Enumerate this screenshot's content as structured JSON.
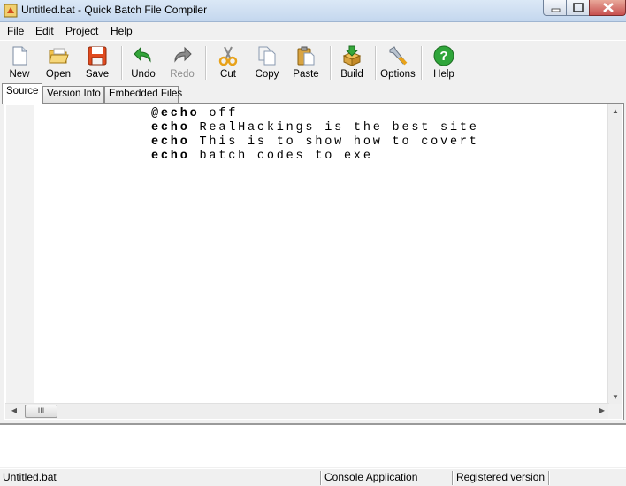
{
  "window": {
    "title": "Untitled.bat - Quick Batch File Compiler"
  },
  "menu": [
    "File",
    "Edit",
    "Project",
    "Help"
  ],
  "toolbar": {
    "new": "New",
    "open": "Open",
    "save": "Save",
    "undo": "Undo",
    "redo": "Redo",
    "cut": "Cut",
    "copy": "Copy",
    "paste": "Paste",
    "build": "Build",
    "options": "Options",
    "help": "Help"
  },
  "tabs": [
    "Source",
    "Version Info",
    "Embedded Files"
  ],
  "editor": {
    "lines": [
      {
        "keyword": "@echo",
        "rest": " off"
      },
      {
        "keyword": "echo",
        "rest": " RealHackings is the best site"
      },
      {
        "keyword": "echo",
        "rest": " This is to show how to covert"
      },
      {
        "keyword": "echo",
        "rest": " batch codes to exe"
      }
    ],
    "hscroll_thumb": "III"
  },
  "status": {
    "file": "Untitled.bat",
    "type": "Console Application",
    "registration": "Registered version"
  },
  "colors": {
    "title_bar": "#c4d7ee",
    "close_button": "#c75050",
    "help_icon": "#2fa53a"
  }
}
